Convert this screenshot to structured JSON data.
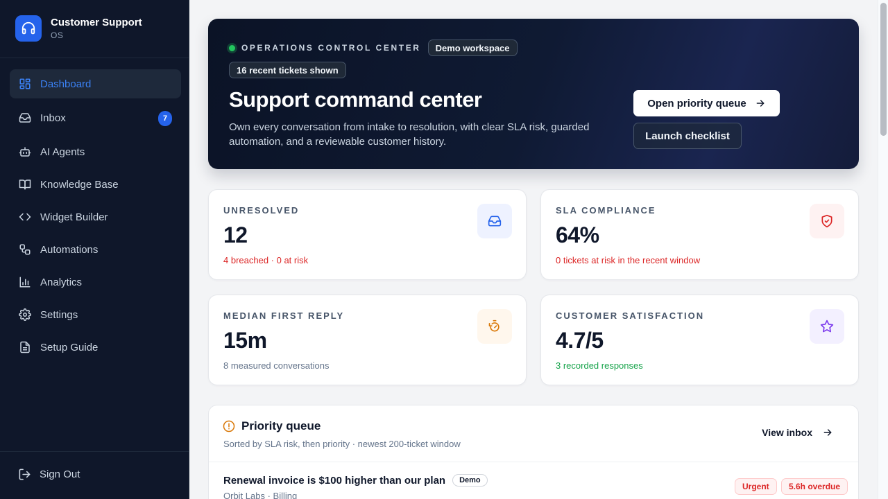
{
  "brand": {
    "name": "Customer Support",
    "sub": "OS"
  },
  "nav": [
    {
      "label": "Dashboard",
      "icon": "dashboard-icon",
      "active": true
    },
    {
      "label": "Inbox",
      "icon": "inbox-icon",
      "badge": "7"
    },
    {
      "label": "AI Agents",
      "icon": "bot-icon"
    },
    {
      "label": "Knowledge Base",
      "icon": "book-icon"
    },
    {
      "label": "Widget Builder",
      "icon": "code-icon"
    },
    {
      "label": "Automations",
      "icon": "workflow-icon"
    },
    {
      "label": "Analytics",
      "icon": "chart-icon"
    },
    {
      "label": "Settings",
      "icon": "gear-icon"
    },
    {
      "label": "Setup Guide",
      "icon": "document-icon"
    }
  ],
  "signout": {
    "label": "Sign Out"
  },
  "hero": {
    "kicker": "OPERATIONS CONTROL CENTER",
    "workspace_pill": "Demo workspace",
    "tickets_pill": "16 recent tickets shown",
    "title": "Support command center",
    "description": "Own every conversation from intake to resolution, with clear SLA risk, guarded automation, and a reviewable customer history.",
    "primary_button": "Open priority queue",
    "secondary_button": "Launch checklist"
  },
  "metrics": {
    "unresolved": {
      "label": "UNRESOLVED",
      "value": "12",
      "sub": "4 breached · 0 at risk"
    },
    "sla": {
      "label": "SLA COMPLIANCE",
      "value": "64%",
      "sub": "0 tickets at risk in the recent window"
    },
    "first_reply": {
      "label": "MEDIAN FIRST REPLY",
      "value": "15m",
      "sub": "8 measured conversations"
    },
    "csat": {
      "label": "CUSTOMER SATISFACTION",
      "value": "4.7/5",
      "sub": "3 recorded responses"
    }
  },
  "queue": {
    "title": "Priority queue",
    "subtitle": "Sorted by SLA risk, then priority · newest 200-ticket window",
    "view_link": "View inbox",
    "rows": [
      {
        "title": "Renewal invoice is $100 higher than our plan",
        "tag": "Demo",
        "sub": "Orbit Labs · Billing",
        "priority": "Urgent",
        "sla": "5.6h overdue"
      }
    ]
  },
  "colors": {
    "sidebar_bg": "#0f172a",
    "accent": "#2563eb",
    "danger": "#dc2626",
    "success": "#16a34a",
    "warning": "#d97706"
  }
}
